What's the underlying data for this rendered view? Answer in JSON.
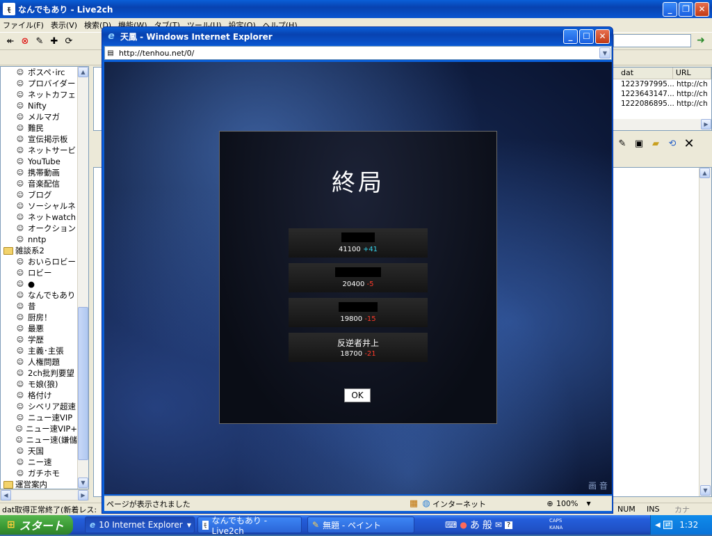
{
  "main_window": {
    "title": "なんでもあり - Live2ch",
    "menu": [
      "ファイル(F)",
      "表示(V)",
      "検索(D)",
      "機能(W)",
      "タブ(T)",
      "ツール(U)",
      "設定(O)",
      "ヘルプ(H)"
    ]
  },
  "board_tree": {
    "items": [
      {
        "label": "ポスペ･irc",
        "type": "board"
      },
      {
        "label": "プロバイダー",
        "type": "board"
      },
      {
        "label": "ネットカフェ",
        "type": "board"
      },
      {
        "label": "Nifty",
        "type": "board"
      },
      {
        "label": "メルマガ",
        "type": "board"
      },
      {
        "label": "難民",
        "type": "board"
      },
      {
        "label": "宣伝掲示板",
        "type": "board"
      },
      {
        "label": "ネットサービ",
        "type": "board"
      },
      {
        "label": "YouTube",
        "type": "board"
      },
      {
        "label": "携帯動画",
        "type": "board"
      },
      {
        "label": "音楽配信",
        "type": "board"
      },
      {
        "label": "ブログ",
        "type": "board"
      },
      {
        "label": "ソーシャルネ",
        "type": "board"
      },
      {
        "label": "ネットwatch",
        "type": "board"
      },
      {
        "label": "オークション",
        "type": "board"
      },
      {
        "label": "nntp",
        "type": "board"
      },
      {
        "label": "雑談系2",
        "type": "folder"
      },
      {
        "label": "おいらロビー",
        "type": "board"
      },
      {
        "label": "ロビー",
        "type": "board"
      },
      {
        "label": "●",
        "type": "board"
      },
      {
        "label": "なんでもあり",
        "type": "board"
      },
      {
        "label": "昔",
        "type": "board"
      },
      {
        "label": "厨房！",
        "type": "board"
      },
      {
        "label": "最悪",
        "type": "board"
      },
      {
        "label": "学歴",
        "type": "board"
      },
      {
        "label": "主義･主張",
        "type": "board"
      },
      {
        "label": "人権問題",
        "type": "board"
      },
      {
        "label": "2ch批判要望",
        "type": "board"
      },
      {
        "label": "モ娘(狼)",
        "type": "board"
      },
      {
        "label": "格付け",
        "type": "board"
      },
      {
        "label": "シベリア超速",
        "type": "board"
      },
      {
        "label": "ニュー速VIP",
        "type": "board"
      },
      {
        "label": "ニュー速VIP+",
        "type": "board"
      },
      {
        "label": "ニュー速(嫌儲",
        "type": "board"
      },
      {
        "label": "天国",
        "type": "board"
      },
      {
        "label": "ニー速",
        "type": "board"
      },
      {
        "label": "ガチホモ",
        "type": "board"
      },
      {
        "label": "運営案内",
        "type": "folder"
      }
    ]
  },
  "thread_list": {
    "headers": [
      "dat",
      "URL"
    ],
    "rows": [
      {
        "dat": "1223797995...",
        "url": "http://ch"
      },
      {
        "dat": "1223643147...",
        "url": "http://ch"
      },
      {
        "dat": "1222086895...",
        "url": "http://ch"
      }
    ]
  },
  "main_status": {
    "text": "dat取得正常終了(新着レス:",
    "num": "NUM",
    "ins": "INS",
    "kana": "カナ"
  },
  "ie_window": {
    "title": "天鳳 - Windows Internet Explorer",
    "url": "http://tenhou.net/0/",
    "status": "ページが表示されました",
    "zone": "インターネット",
    "zoom": "100%",
    "corner_text": "画 音"
  },
  "game_dialog": {
    "title": "終局",
    "players": [
      {
        "name": "",
        "redacted": true,
        "score": "41100",
        "delta": "+41",
        "delta_sign": "pos"
      },
      {
        "name": "",
        "redacted": true,
        "score": "20400",
        "delta": "-5",
        "delta_sign": "neg"
      },
      {
        "name": "",
        "redacted": true,
        "score": "19800",
        "delta": "-15",
        "delta_sign": "neg"
      },
      {
        "name": "反逆者井上",
        "redacted": false,
        "score": "18700",
        "delta": "-21",
        "delta_sign": "neg"
      }
    ],
    "ok_label": "OK"
  },
  "taskbar": {
    "start_label": "スタート",
    "buttons": [
      {
        "label": "10 Internet Explorer",
        "icon": "ie-icon"
      },
      {
        "label": "なんでもあり - Live2ch",
        "icon": "monar-icon"
      },
      {
        "label": "無題 - ペイント",
        "icon": "paint-icon"
      }
    ],
    "ime": [
      "あ",
      "般"
    ],
    "caps": "CAPS",
    "kana": "KANA",
    "clock": "1:32"
  },
  "colors": {
    "xp_blue": "#0a5fd8",
    "delta_positive": "#37d7f0",
    "delta_negative": "#ff3a2a"
  }
}
